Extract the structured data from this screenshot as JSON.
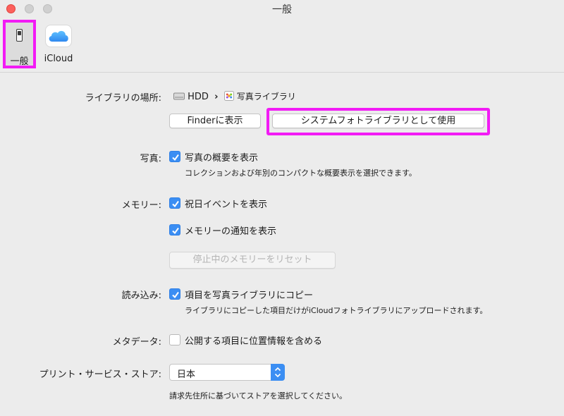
{
  "window": {
    "title": "一般"
  },
  "toolbar": {
    "general_label": "一般",
    "icloud_label": "iCloud",
    "general_icon": "switch-icon",
    "icloud_icon": "icloud-icon"
  },
  "library": {
    "label": "ライブラリの場所:",
    "drive": "HDD",
    "separator": "›",
    "library_name": "写真ライブラリ",
    "show_in_finder": "Finderに表示",
    "use_as_system": "システムフォトライブラリとして使用"
  },
  "photos": {
    "label": "写真:",
    "summarize": "写真の概要を表示",
    "summarize_desc": "コレクションおよび年別のコンパクトな概要表示を選択できます。",
    "summarize_checked": true
  },
  "memories": {
    "label": "メモリー:",
    "holiday_events": "祝日イベントを表示",
    "holiday_checked": true,
    "notifications": "メモリーの通知を表示",
    "notifications_checked": true,
    "reset_blocked": "停止中のメモリーをリセット"
  },
  "importing": {
    "label": "読み込み:",
    "copy_items": "項目を写真ライブラリにコピー",
    "copy_checked": true,
    "copy_desc": "ライブラリにコピーした項目だけがiCloudフォトライブラリにアップロードされます。"
  },
  "metadata": {
    "label": "メタデータ:",
    "include_location": "公開する項目に位置情報を含める",
    "location_checked": false
  },
  "print_store": {
    "label": "プリント・サービス・ストア:",
    "selected": "日本",
    "desc": "請求先住所に基づいてストアを選択してください。"
  },
  "colors": {
    "highlight": "#f21bf5",
    "accent": "#3b8ef3",
    "close": "#fc605c"
  }
}
